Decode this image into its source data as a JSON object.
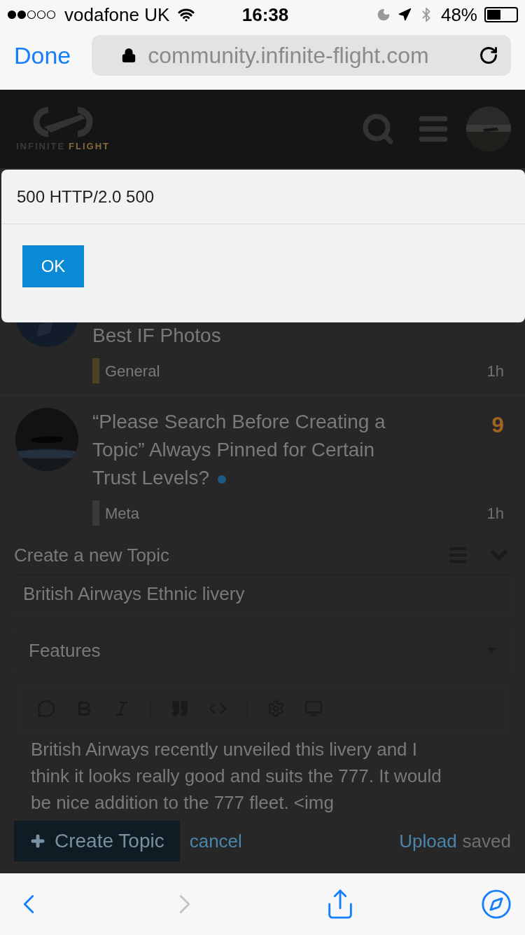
{
  "status_bar": {
    "carrier": "vodafone UK",
    "time": "16:38",
    "battery": "48%"
  },
  "browser": {
    "done": "Done",
    "url": "community.infinite-flight.com"
  },
  "header": {
    "logo_words": [
      {
        "text": "INFINITE",
        "color": "#3a3a3a"
      },
      {
        "text": "FLIGHT",
        "color": "#8a6a3a"
      }
    ]
  },
  "dialog": {
    "message": "500 HTTP/2.0 500",
    "button": "OK"
  },
  "topics": [
    {
      "title": "Best IF Photos",
      "category": "General",
      "color": "#4a4224",
      "age": "1h",
      "unread": false
    },
    {
      "title": "“Please Search Before Creating a Topic” Always Pinned for Certain Trust Levels?",
      "category": "Meta",
      "color": "#3a3a3a",
      "age": "1h",
      "replies": "9",
      "unread": true
    }
  ],
  "composer": {
    "title": "Create a new Topic",
    "topic_title": "British Airways Ethnic livery",
    "category": "Features",
    "toolbar": [
      {
        "kind": "speech"
      },
      {
        "kind": "bold"
      },
      {
        "kind": "italic"
      },
      {
        "kind": "divider"
      },
      {
        "kind": "quote"
      },
      {
        "kind": "code"
      },
      {
        "kind": "divider"
      },
      {
        "kind": "gear"
      },
      {
        "kind": "monitor"
      }
    ],
    "body": "British Airways recently unveiled this livery and I think it looks really good and suits the 777. It would be nice addition to the 777 fleet. <img",
    "create": "Create Topic",
    "cancel": "cancel",
    "upload": "Upload",
    "status": "saved"
  },
  "bottom_bar": [
    {
      "kind": "back",
      "disabled": false
    },
    {
      "kind": "forward",
      "disabled": true
    },
    {
      "kind": "share",
      "disabled": false
    },
    {
      "kind": "compass",
      "disabled": false
    }
  ]
}
